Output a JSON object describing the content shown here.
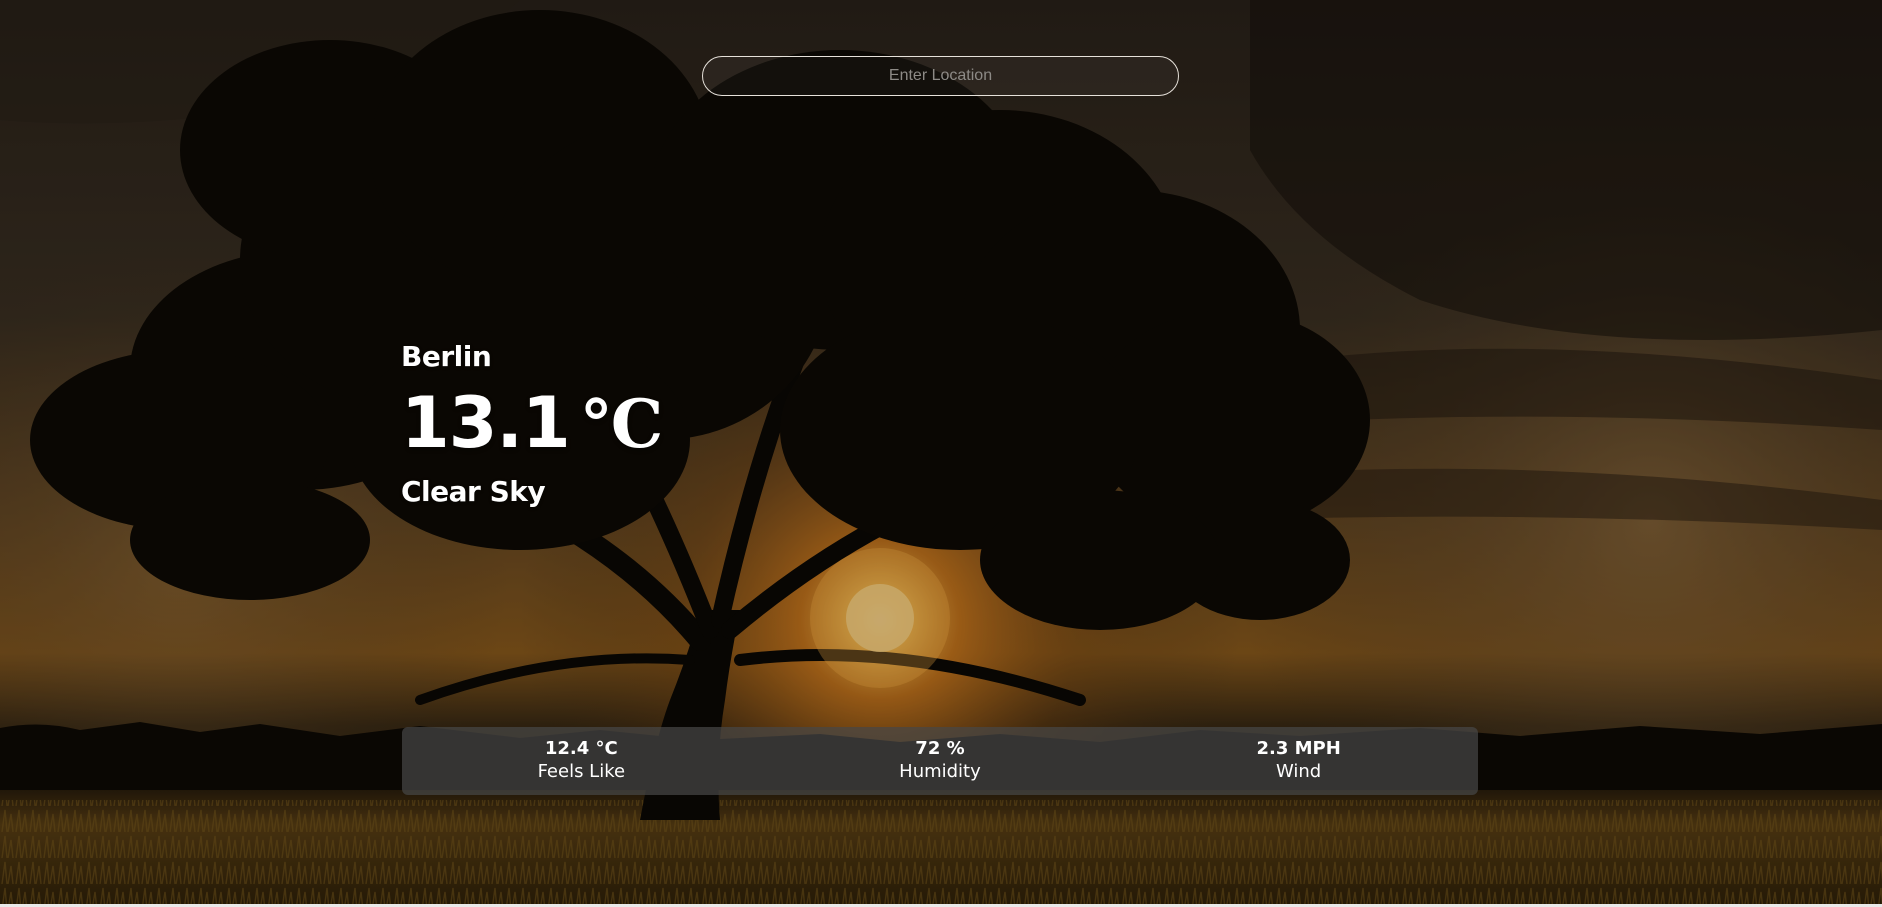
{
  "search": {
    "placeholder": "Enter Location",
    "value": ""
  },
  "weather": {
    "location": "Berlin",
    "temperature": "13.1",
    "unit": "°C",
    "description": "Clear Sky"
  },
  "details": [
    {
      "value": "12.4 °C",
      "label": "Feels Like"
    },
    {
      "value": "72 %",
      "label": "Humidity"
    },
    {
      "value": "2.3 MPH",
      "label": "Wind"
    }
  ],
  "colors": {
    "sky_dark": "#1b140d",
    "sun_glow": "#ffb23a",
    "field": "#4a3512",
    "panel": "#464646"
  },
  "icons": {
    "background": "sunset-tree-photo"
  }
}
